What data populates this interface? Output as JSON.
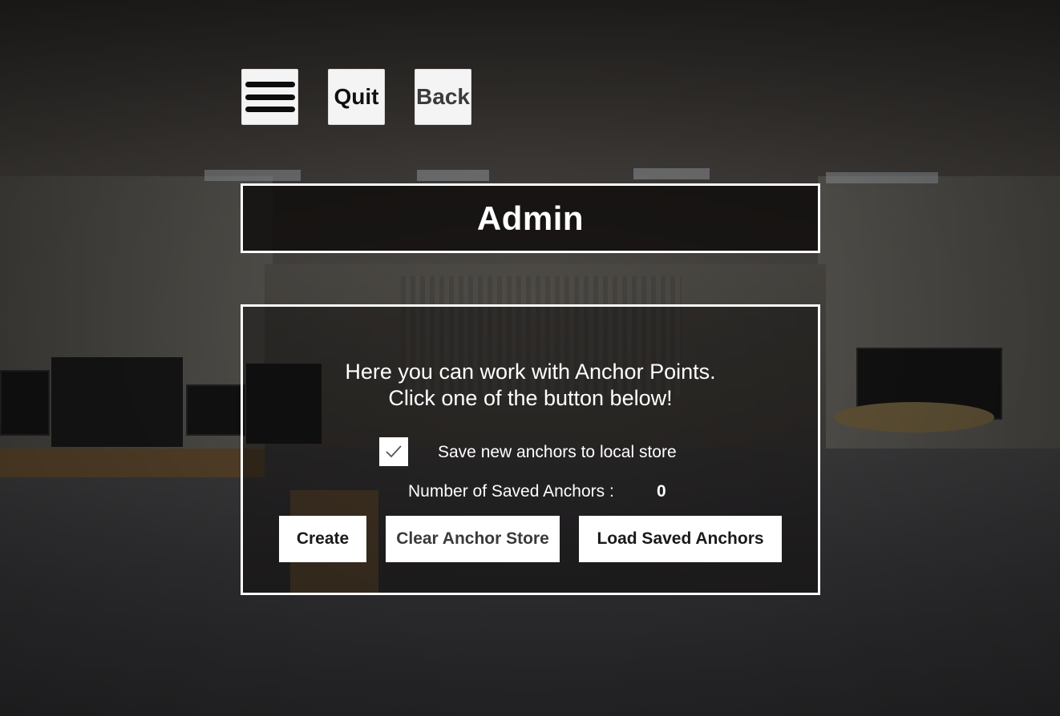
{
  "toolbar": {
    "quit_label": "Quit",
    "back_label": "Back",
    "menu_icon": "hamburger-menu-icon"
  },
  "header": {
    "title": "Admin"
  },
  "panel": {
    "instruction_line1": "Here you can work with Anchor Points.",
    "instruction_line2": "Click one of the button below!",
    "save_checkbox": {
      "label": "Save new anchors to local store",
      "checked": true,
      "icon": "checkmark-icon"
    },
    "saved_count_label": "Number of Saved Anchors :",
    "saved_count_value": "0",
    "buttons": {
      "create": "Create",
      "clear": "Clear Anchor Store",
      "load": "Load Saved Anchors"
    }
  }
}
